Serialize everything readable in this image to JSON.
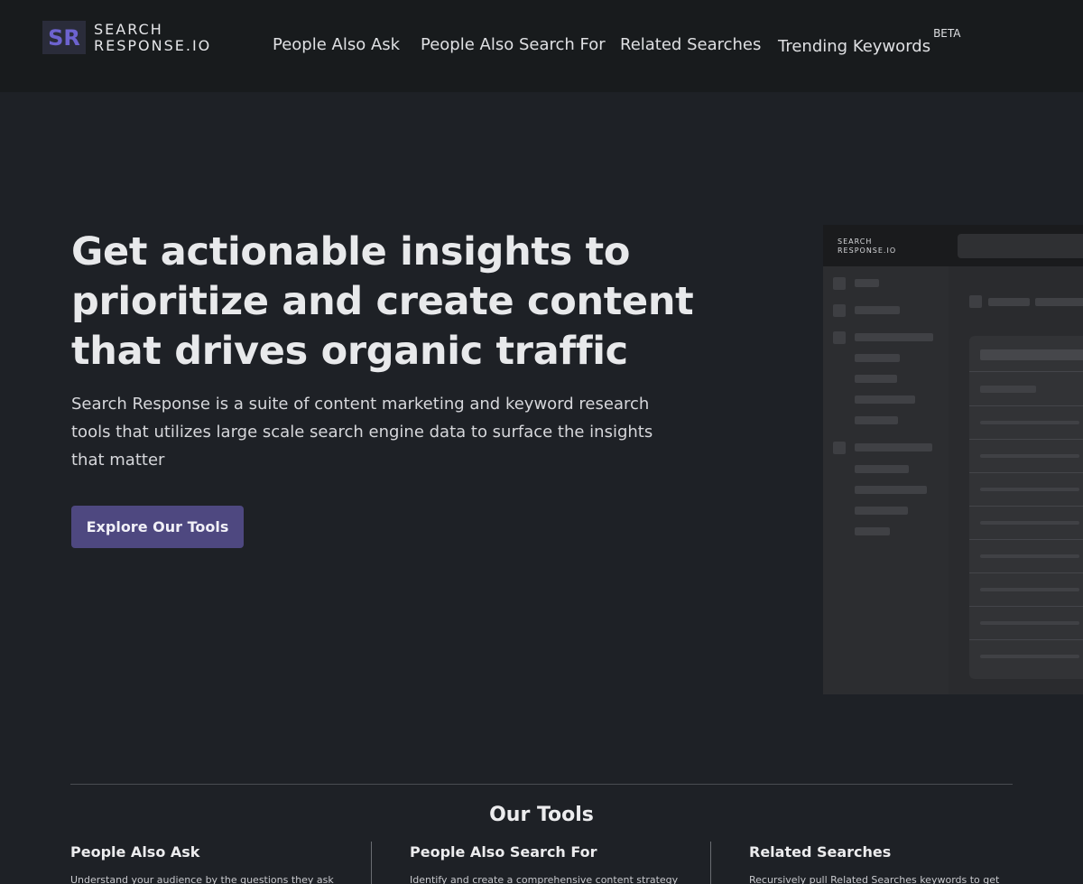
{
  "header": {
    "logo_mark": "SR",
    "logo_line1": "SEARCH",
    "logo_line2": "RESPONSE.IO",
    "nav": [
      {
        "label": "People Also Ask"
      },
      {
        "label": "People Also Search For"
      },
      {
        "label": "Related Searches"
      },
      {
        "label": "Trending Keywords",
        "badge": "BETA"
      }
    ]
  },
  "hero": {
    "title": "Get actionable insights to prioritize and create content that drives organic traffic",
    "subtitle": "Search Response is a suite of content marketing and keyword research tools that utilizes large scale search engine data to surface the insights that matter",
    "cta_label": "Explore Our Tools"
  },
  "preview": {
    "logo_line1": "SEARCH",
    "logo_line2": "RESPONSE.IO"
  },
  "tools": {
    "title": "Our Tools",
    "items": [
      {
        "name": "People Also Ask",
        "desc": "Understand your audience by the questions they ask"
      },
      {
        "name": "People Also Search For",
        "desc": "Identify and create a comprehensive content strategy"
      },
      {
        "name": "Related Searches",
        "desc": "Recursively pull Related Searches keywords to get"
      }
    ]
  },
  "colors": {
    "background": "#1e2126",
    "header": "#181b1d",
    "accent": "#4e4880",
    "logo_mark": "#6d63cf"
  }
}
